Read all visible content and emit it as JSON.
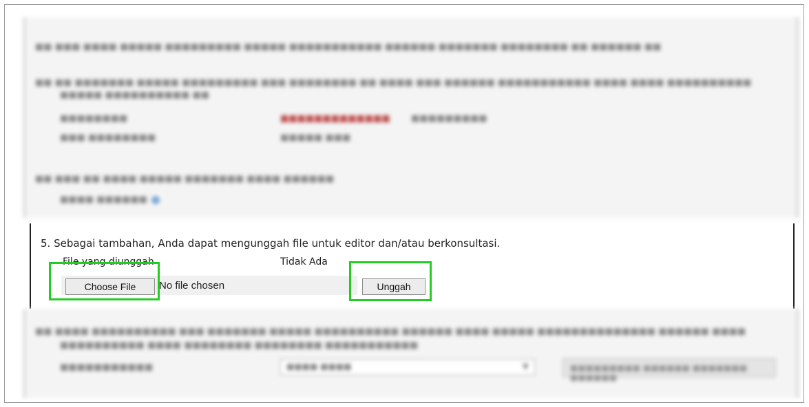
{
  "step5": {
    "text": "5. Sebagai tambahan, Anda dapat mengunggah file untuk editor dan/atau berkonsultasi.",
    "file_label": "File yang diunggah",
    "file_value": "Tidak Ada",
    "choose_label": "Choose File",
    "no_file_text": "No file chosen",
    "upload_label": "Unggah"
  },
  "colors": {
    "highlight": "#22cc22",
    "section_border": "#222222"
  }
}
